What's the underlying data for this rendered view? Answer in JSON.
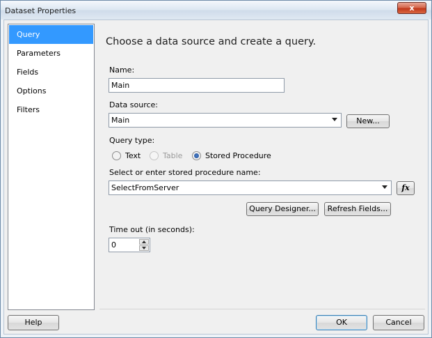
{
  "window": {
    "title": "Dataset Properties",
    "close_glyph": "x"
  },
  "nav": {
    "items": [
      {
        "label": "Query",
        "selected": true
      },
      {
        "label": "Parameters",
        "selected": false
      },
      {
        "label": "Fields",
        "selected": false
      },
      {
        "label": "Options",
        "selected": false
      },
      {
        "label": "Filters",
        "selected": false
      }
    ]
  },
  "main": {
    "heading": "Choose a data source and create a query.",
    "name_label": "Name:",
    "name_value": "Main",
    "datasource_label": "Data source:",
    "datasource_value": "Main",
    "new_button": "New...",
    "query_type_label": "Query type:",
    "query_types": [
      {
        "label": "Text",
        "checked": false,
        "enabled": true
      },
      {
        "label": "Table",
        "checked": false,
        "enabled": false
      },
      {
        "label": "Stored Procedure",
        "checked": true,
        "enabled": true
      }
    ],
    "sp_label": "Select or enter stored procedure name:",
    "sp_value": "SelectFromServer",
    "fx_button": "fx",
    "query_designer_button": "Query Designer...",
    "refresh_fields_button": "Refresh Fields...",
    "timeout_label": "Time out (in seconds):",
    "timeout_value": "0"
  },
  "footer": {
    "help": "Help",
    "ok": "OK",
    "cancel": "Cancel"
  }
}
